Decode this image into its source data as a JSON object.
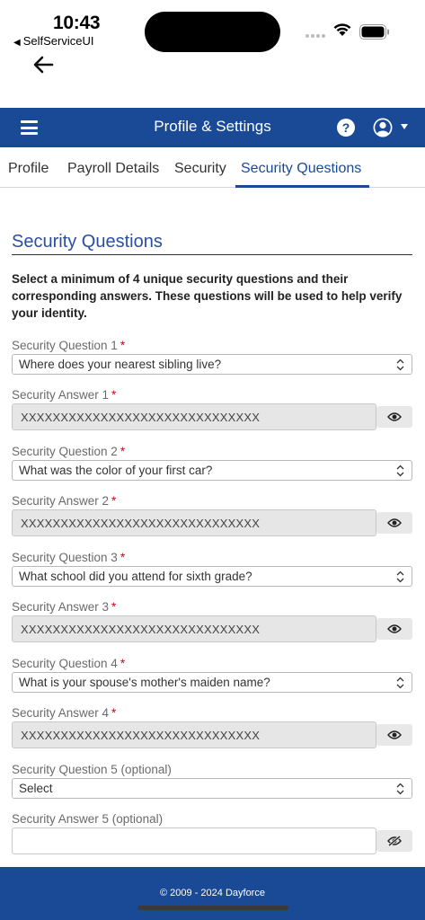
{
  "status_bar": {
    "time": "10:43",
    "back_app": "SelfServiceUI"
  },
  "header": {
    "title": "Profile & Settings",
    "help_icon": "?"
  },
  "tabs": [
    {
      "label": "Profile",
      "active": false
    },
    {
      "label": "Payroll Details",
      "active": false
    },
    {
      "label": "Security",
      "active": false
    },
    {
      "label": "Security Questions",
      "active": true
    }
  ],
  "section": {
    "title": "Security Questions",
    "instructions": "Select a minimum of 4 unique security questions and their corresponding answers. These questions will be used to help verify your identity."
  },
  "questions": [
    {
      "q_label": "Security Question 1",
      "q_required": "*",
      "q_value": "Where does your nearest sibling live?",
      "a_label": "Security Answer 1",
      "a_required": "*",
      "a_value": "XXXXXXXXXXXXXXXXXXXXXXXXXXXXXX"
    },
    {
      "q_label": "Security Question 2",
      "q_required": "*",
      "q_value": "What was the color of your first car?",
      "a_label": "Security Answer 2",
      "a_required": "*",
      "a_value": "XXXXXXXXXXXXXXXXXXXXXXXXXXXXXX"
    },
    {
      "q_label": "Security Question 3",
      "q_required": "*",
      "q_value": "What school did you attend for sixth grade?",
      "a_label": "Security Answer 3",
      "a_required": "*",
      "a_value": "XXXXXXXXXXXXXXXXXXXXXXXXXXXXXX"
    },
    {
      "q_label": "Security Question 4",
      "q_required": "*",
      "q_value": "What is your spouse's mother's maiden name?",
      "a_label": "Security Answer 4",
      "a_required": "*",
      "a_value": "XXXXXXXXXXXXXXXXXXXXXXXXXXXXXX"
    },
    {
      "q_label": "Security Question 5 (optional)",
      "q_value": "Select",
      "a_label": "Security Answer 5 (optional)",
      "a_value": ""
    }
  ],
  "footer": {
    "copyright": "© 2009 - 2024 Dayforce"
  },
  "colors": {
    "brand": "#1a4a96",
    "required": "#d0021b"
  }
}
